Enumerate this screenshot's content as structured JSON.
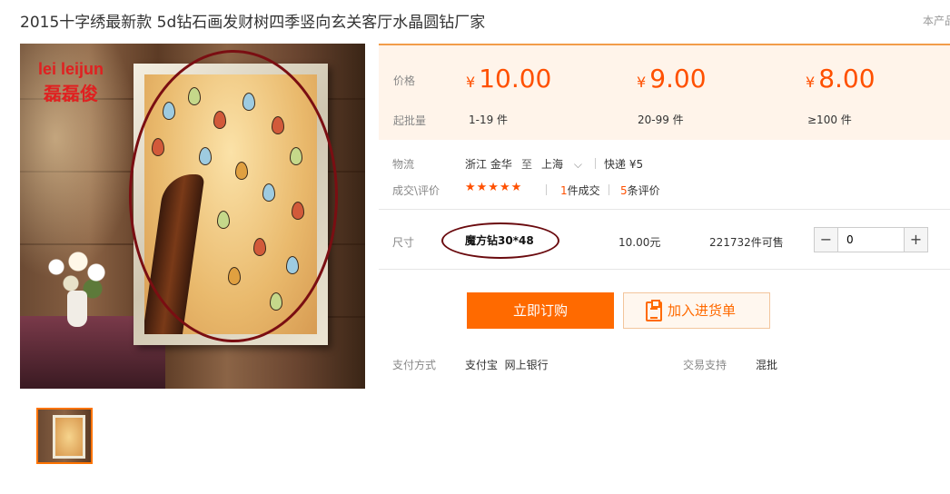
{
  "header": {
    "title": "2015十字绣最新款 5d钻石画发财树四季竖向玄关客厅水晶圆钻厂家",
    "right_text": "本产品"
  },
  "gallery": {
    "watermark_line1": "lei leijun",
    "watermark_line2": "磊磊俊"
  },
  "price_panel": {
    "price_label": "价格",
    "moq_label": "起批量",
    "currency": "¥",
    "tiers": [
      {
        "price": "10.00",
        "range": "1-19 件"
      },
      {
        "price": "9.00",
        "range": "20-99 件"
      },
      {
        "price": "8.00",
        "range": "≥100 件"
      }
    ]
  },
  "logistics": {
    "label": "物流",
    "origin": "浙江 金华",
    "to": "至",
    "destination": "上海",
    "shipping": "快递 ¥5"
  },
  "reviews": {
    "label": "成交\\评价",
    "stars": "★★★★★",
    "rating": 5,
    "deals_count": "1",
    "deals_text": "件成交",
    "reviews_count": "5",
    "reviews_text": "条评价"
  },
  "size": {
    "label": "尺寸",
    "option": "魔方钻30*48",
    "price": "10.00元",
    "stock": "221732件可售",
    "quantity": "0"
  },
  "actions": {
    "buy": "立即订购",
    "add_to_list": "加入进货单"
  },
  "payment": {
    "label": "支付方式",
    "methods": "支付宝  网上银行",
    "trade_label": "交易支持",
    "trade_value": "混批"
  },
  "colors": {
    "accent": "#ff5000",
    "button": "#ff6a00",
    "panel_bg": "#fff4ea",
    "annotation": "#7a0e12"
  }
}
